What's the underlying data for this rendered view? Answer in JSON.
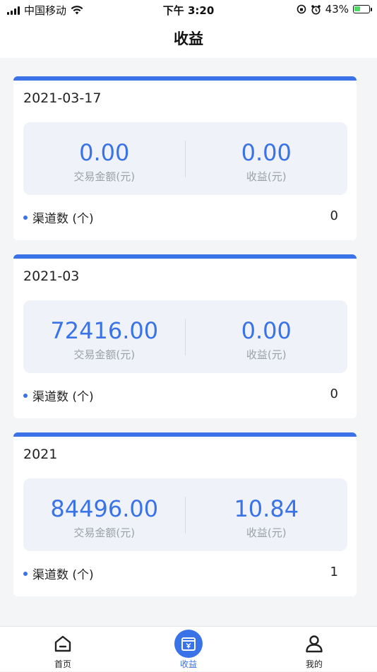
{
  "status_bar": {
    "carrier": "中国移动",
    "time": "下午 3:20",
    "battery": "43%",
    "battery_level": 0.43
  },
  "header": {
    "title": "收益"
  },
  "cards": [
    {
      "date": "2021-03-17",
      "amount_value": "0.00",
      "amount_label": "交易金额(元)",
      "earn_value": "0.00",
      "earn_label": "收益(元)",
      "channels_label": "渠道数 (个)",
      "channels_count": "0"
    },
    {
      "date": "2021-03",
      "amount_value": "72416.00",
      "amount_label": "交易金额(元)",
      "earn_value": "0.00",
      "earn_label": "收益(元)",
      "channels_label": "渠道数 (个)",
      "channels_count": "0"
    },
    {
      "date": "2021",
      "amount_value": "84496.00",
      "amount_label": "交易金额(元)",
      "earn_value": "10.84",
      "earn_label": "收益(元)",
      "channels_label": "渠道数 (个)",
      "channels_count": "1"
    }
  ],
  "tabbar": {
    "items": [
      {
        "label": "首页",
        "icon": "home-icon",
        "active": false
      },
      {
        "label": "收益",
        "icon": "wallet-icon",
        "active": true
      },
      {
        "label": "我的",
        "icon": "user-icon",
        "active": false
      }
    ]
  },
  "colors": {
    "accent": "#3a72e8",
    "panel": "#eff2f9",
    "muted": "#9a9fa8"
  }
}
